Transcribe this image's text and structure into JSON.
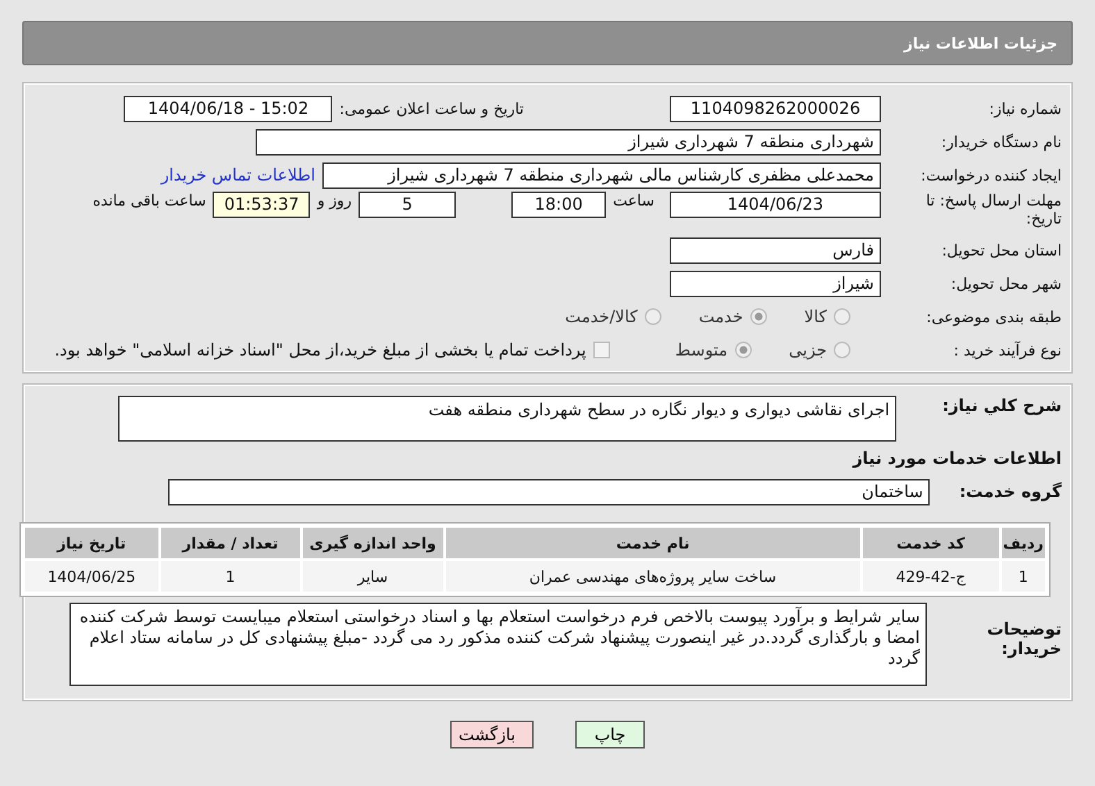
{
  "header": {
    "title": "جزئیات اطلاعات نیاز"
  },
  "need_number": {
    "label": "شماره نیاز:",
    "value": "1104098262000026"
  },
  "announce": {
    "label": "تاریخ و ساعت اعلان عمومی:",
    "value": "1404/06/18 - 15:02"
  },
  "buyer_org": {
    "label": "نام دستگاه خریدار:",
    "value": "شهرداری منطقه 7 شهرداری شیراز"
  },
  "requester": {
    "label": "ایجاد کننده درخواست:",
    "value": "محمدعلی مظفری کارشناس مالی شهرداری منطقه 7 شهرداری شیراز",
    "link": "اطلاعات تماس خریدار"
  },
  "deadline": {
    "label": "مهلت ارسال پاسخ: تا تاریخ:",
    "date": "1404/06/23",
    "time_label": "ساعت",
    "time": "18:00",
    "days": "5",
    "days_label": "روز و",
    "remaining": "01:53:37",
    "remaining_label": "ساعت باقی مانده"
  },
  "province": {
    "label": "استان محل تحویل:",
    "value": "فارس"
  },
  "city": {
    "label": "شهر محل تحویل:",
    "value": "شیراز"
  },
  "category": {
    "label": "طبقه بندی موضوعی:",
    "options": [
      {
        "label": "کالا",
        "selected": false
      },
      {
        "label": "خدمت",
        "selected": true
      },
      {
        "label": "کالا/خدمت",
        "selected": false
      }
    ]
  },
  "process": {
    "label": "نوع فرآیند خرید :",
    "options": [
      {
        "label": "جزیی",
        "selected": false
      },
      {
        "label": "متوسط",
        "selected": true
      }
    ],
    "payment": {
      "checked": false,
      "label": "پرداخت تمام یا بخشی از مبلغ خرید،از محل \"اسناد خزانه اسلامی\" خواهد بود."
    }
  },
  "summary": {
    "label": "شرح کلي نياز:",
    "value": "اجرای نقاشی دیواری و دیوار نگاره در سطح شهرداری منطقه هفت"
  },
  "services_title": "اطلاعات خدمات مورد نیاز",
  "service_group": {
    "label": "گروه خدمت:",
    "value": "ساختمان"
  },
  "table": {
    "columns": [
      "ردیف",
      "کد خدمت",
      "نام خدمت",
      "واحد اندازه گیری",
      "تعداد / مقدار",
      "تاریخ نیاز"
    ],
    "rows": [
      [
        "1",
        "ج-42-429",
        "ساخت سایر پروژه‌های مهندسی عمران",
        "سایر",
        "1",
        "1404/06/25"
      ]
    ]
  },
  "buyer_notes": {
    "label": "توضیحات خریدار:",
    "value": "سایر شرایط و برآورد پیوست  بالاخص فرم درخواست استعلام بها و اسناد درخواستی استعلام میبایست توسط شرکت کننده امضا و بارگذاری گردد.در غیر اینصورت پیشنهاد شرکت کننده مذکور رد می گردد -مبلغ پیشنهادی کل در سامانه ستاد اعلام گردد"
  },
  "buttons": [
    {
      "kind": "print",
      "label": "چاپ"
    },
    {
      "kind": "back",
      "label": "بازگشت"
    }
  ]
}
